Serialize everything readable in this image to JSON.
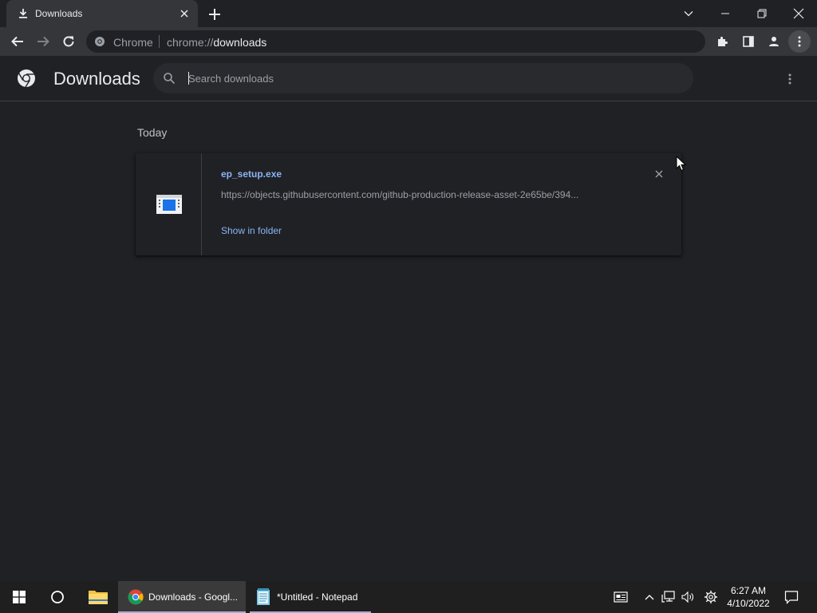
{
  "browser": {
    "tab_title": "Downloads",
    "omnibox_site": "Chrome",
    "url_scheme": "chrome://",
    "url_host": "downloads"
  },
  "downloads": {
    "title": "Downloads",
    "search_placeholder": "Search downloads",
    "section_date": "Today",
    "items": [
      {
        "filename": "ep_setup.exe",
        "url": "https://objects.githubusercontent.com/github-production-release-asset-2e65be/394...",
        "action": "Show in folder"
      }
    ]
  },
  "taskbar": {
    "apps": [
      {
        "label": "Downloads - Googl...",
        "icon": "chrome-icon",
        "active": true
      },
      {
        "label": "*Untitled - Notepad",
        "icon": "notepad-icon",
        "active": false
      }
    ],
    "time": "6:27 AM",
    "date": "4/10/2022"
  },
  "colors": {
    "background": "#202124",
    "toolbar": "#35363a",
    "link": "#8ab4f8",
    "taskbar": "#1f1f1f"
  }
}
